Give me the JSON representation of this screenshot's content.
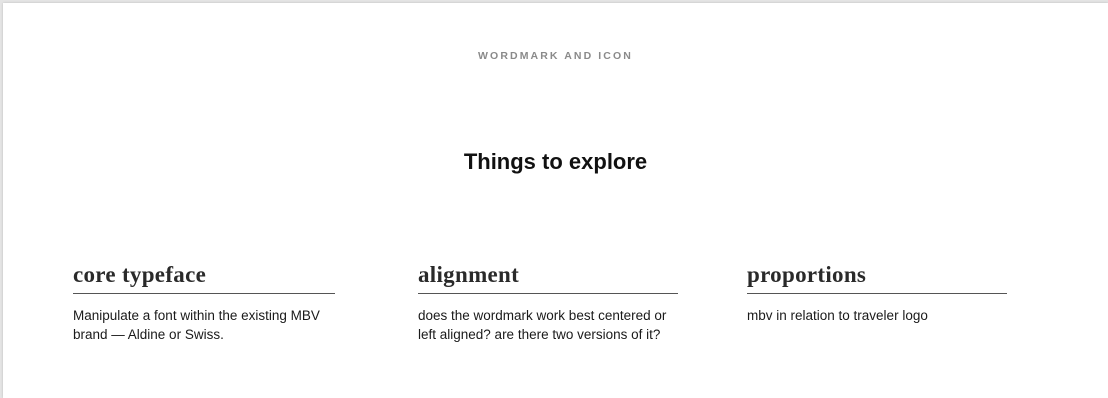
{
  "eyebrow": "WORDMARK AND ICON",
  "heading": "Things to explore",
  "columns": [
    {
      "title": "core typeface",
      "body": "Manipulate a font within the existing MBV brand — Aldine or Swiss."
    },
    {
      "title": "alignment",
      "body": "does the wordmark work best centered or left aligned? are there two versions of it?"
    },
    {
      "title": "proportions",
      "body": "mbv in relation to traveler logo"
    }
  ]
}
